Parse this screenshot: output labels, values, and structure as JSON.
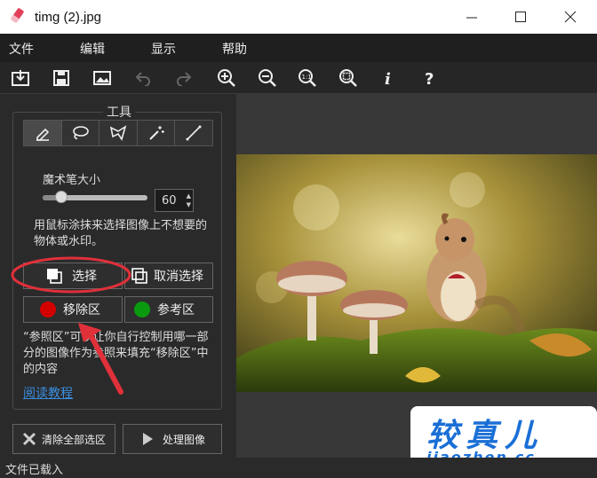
{
  "window": {
    "title": "timg (2).jpg"
  },
  "menu": [
    "文件",
    "编辑",
    "显示",
    "帮助"
  ],
  "sidebar": {
    "group_title": "工具",
    "brush_size_label": "魔术笔大小",
    "brush_size_value": "60",
    "brush_size_level": 0.15,
    "instruction": "用鼠标涂抹来选择图像上不想要的物体或水印。",
    "select_button": "选择",
    "deselect_button": "取消选择",
    "remove_area_button": "移除区",
    "reference_area_button": "参考区",
    "reference_note": "“参照区”可以让你自行控制用哪一部分的图像作为参照来填充“移除区”中的内容",
    "tutorial_link": "阅读教程",
    "clear_all_button": "清除全部选区",
    "process_button": "处理图像"
  },
  "status": {
    "text": "文件已载入"
  },
  "watermark": {
    "line1": "较真儿",
    "line2": "jiaozhen.cc"
  },
  "colors": {
    "remove_dot": "#d40000",
    "reference_dot": "#0a9a10",
    "annotation": "#e0303a",
    "link": "#3b8fe0"
  },
  "icons": {
    "toolbar": [
      "open-icon",
      "save-icon",
      "image-icon",
      "undo-icon",
      "redo-icon",
      "zoom-in-icon",
      "zoom-out-icon",
      "actual-size-icon",
      "fit-icon",
      "info-icon",
      "help-icon"
    ],
    "tools": [
      "brush-icon",
      "lasso-icon",
      "polygon-lasso-icon",
      "magic-wand-icon",
      "line-icon"
    ]
  }
}
